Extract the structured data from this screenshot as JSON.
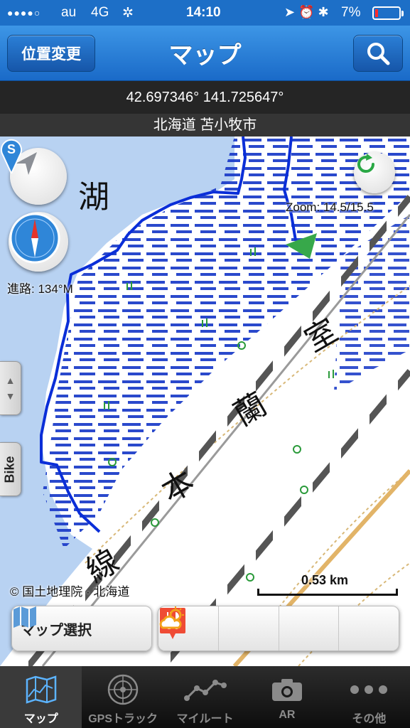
{
  "status_bar": {
    "signal": "●●●●○",
    "carrier": "au",
    "network": "4G",
    "time": "14:10",
    "battery_percent": "7%",
    "battery_level": 0.07
  },
  "nav": {
    "left_button": "位置変更",
    "title": "マップ",
    "right_icon": "search-icon"
  },
  "location": {
    "coordinates": "42.697346° 141.725647°",
    "place_name": "北海道 苫小牧市"
  },
  "map": {
    "zoom_text": "Zoom: 14.5/15.5",
    "heading_text": "進路: 134°M",
    "copyright": "© 国土地理院 · 北海道",
    "scale_label": "0.53 km",
    "side_tab_label": "Bike",
    "start_marker": "S",
    "map_labels": [
      "湖",
      "室",
      "蘭",
      "本",
      "線"
    ]
  },
  "toolbar": {
    "map_select_label": "マップ選択",
    "buttons": [
      "save-icon",
      "add-icon",
      "restaurant-icon",
      "weather-icon"
    ]
  },
  "tabs": [
    {
      "label": "マップ",
      "icon": "map-icon",
      "active": true
    },
    {
      "label": "GPSトラック",
      "icon": "radar-icon",
      "active": false
    },
    {
      "label": "マイルート",
      "icon": "route-icon",
      "active": false
    },
    {
      "label": "AR",
      "icon": "camera-icon",
      "active": false
    },
    {
      "label": "その他",
      "icon": "more-icon",
      "active": false
    }
  ],
  "colors": {
    "nav_blue": "#1a6ac8",
    "track_blue": "#0a2ed8",
    "marsh_blue": "#1f3fc9",
    "water": "#b8d2f2",
    "arrow_green": "#37a84a",
    "pin_blue": "#2f86d8"
  }
}
